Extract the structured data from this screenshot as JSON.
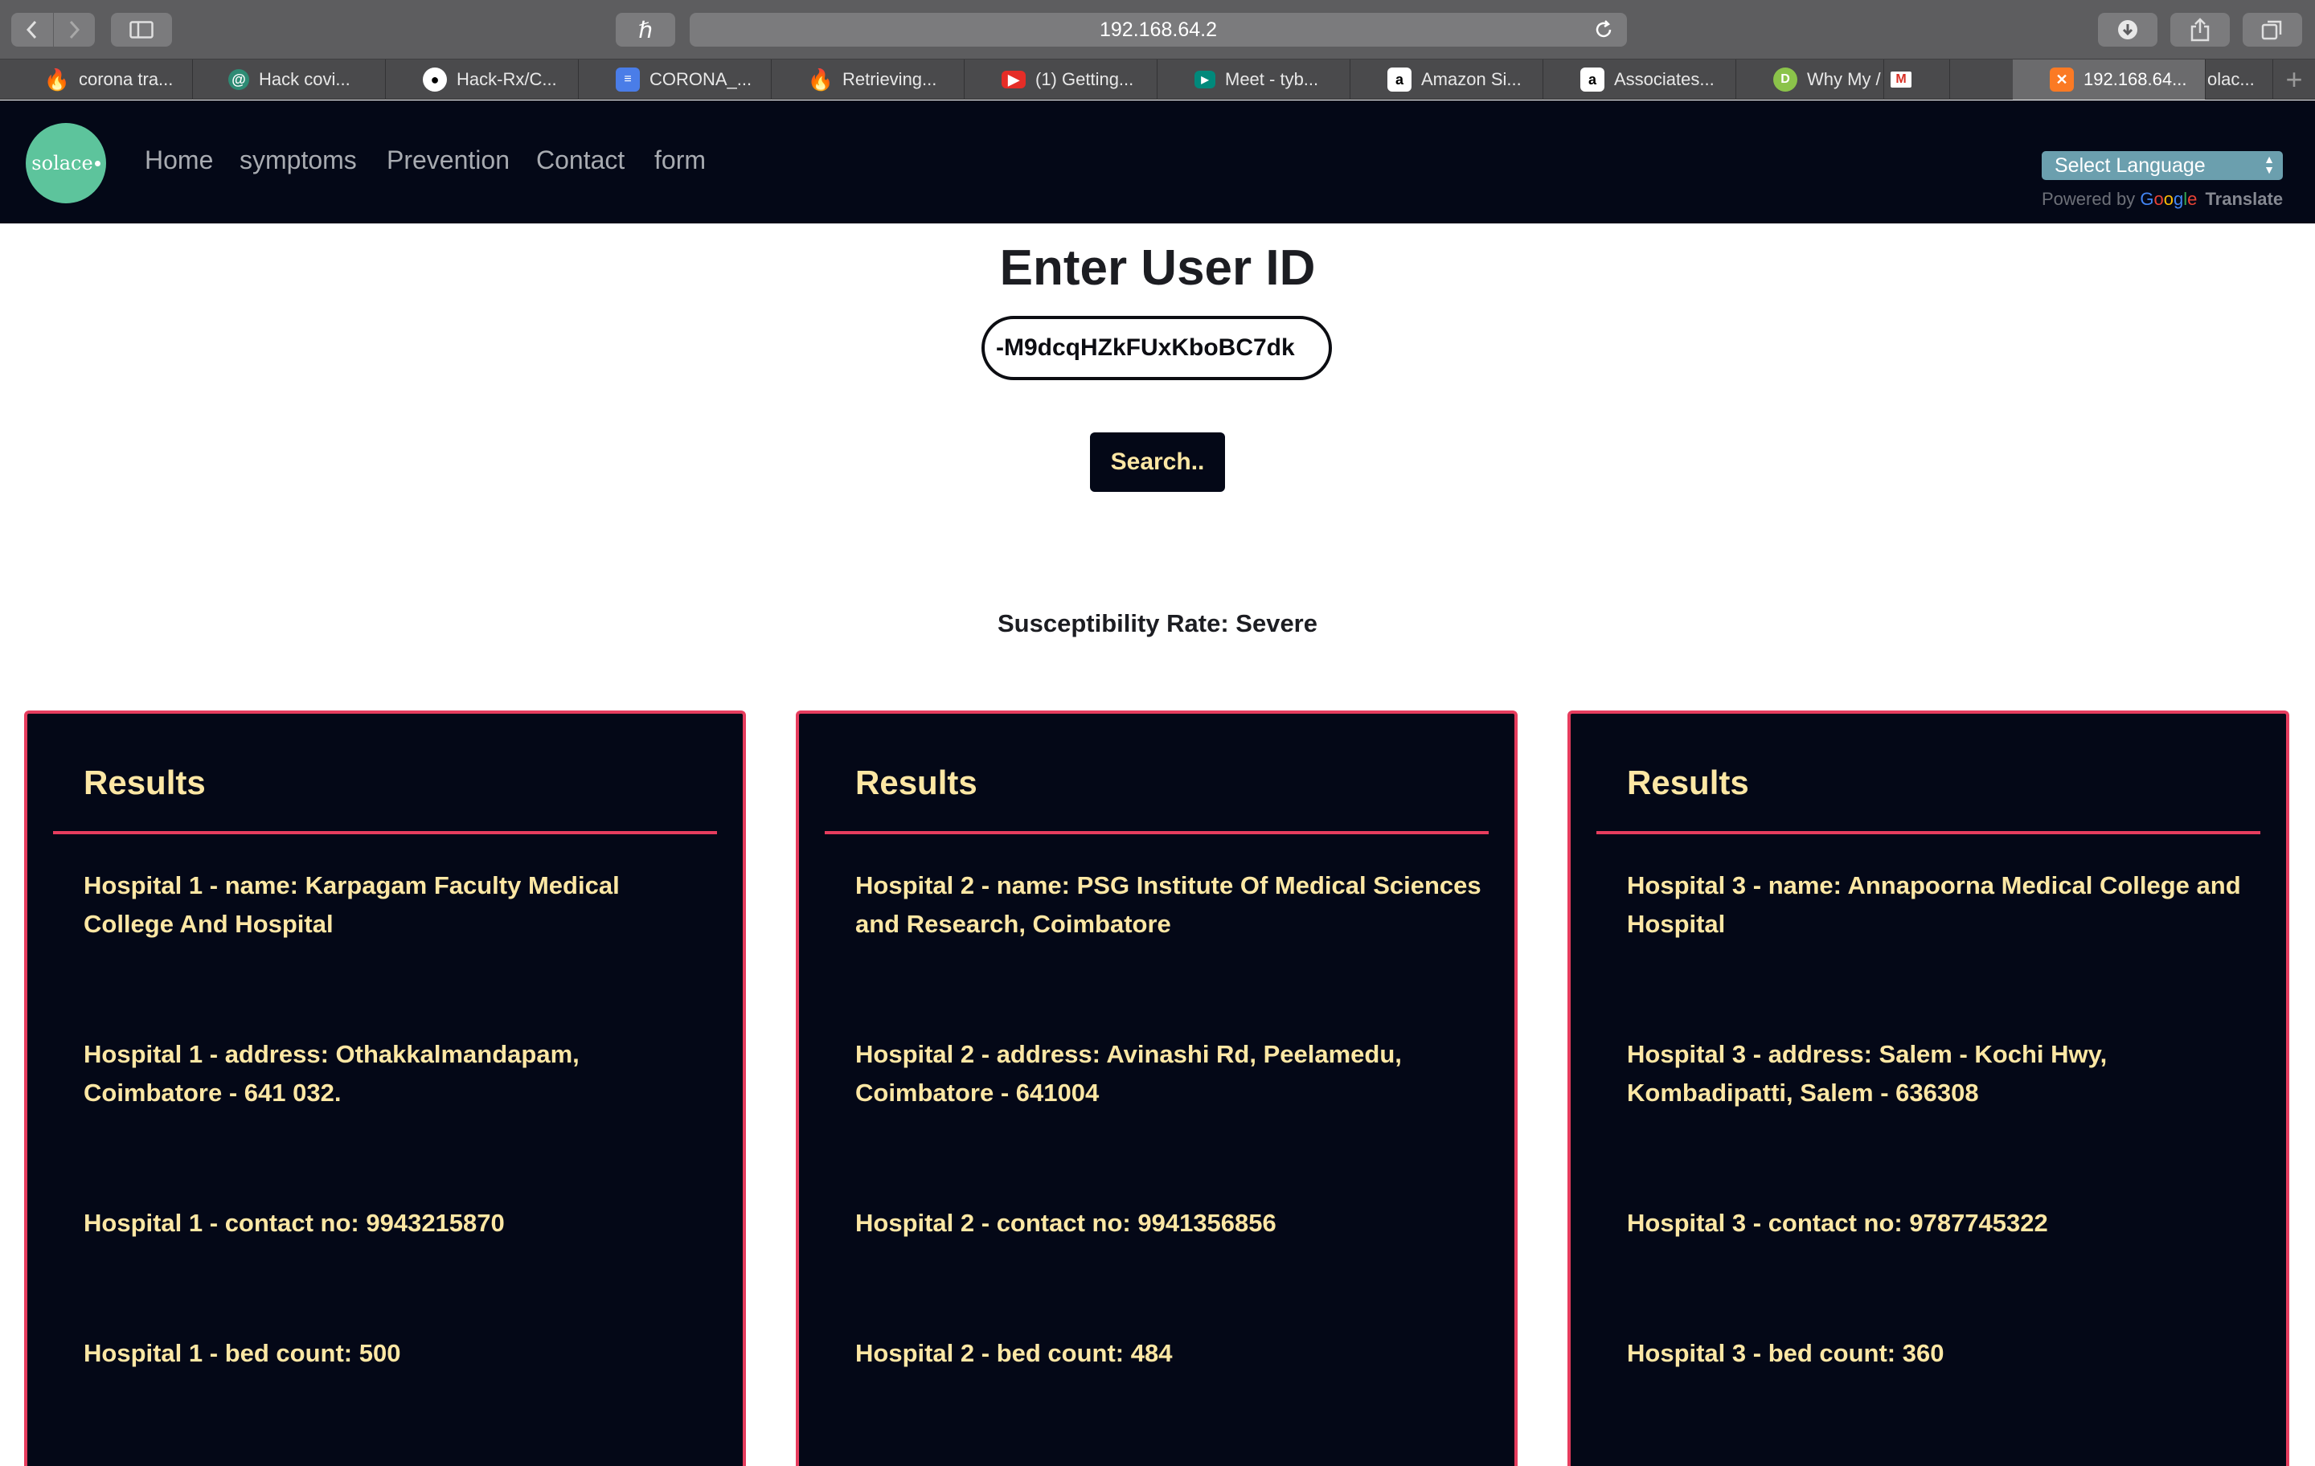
{
  "browser": {
    "address": "192.168.64.2",
    "tabs": [
      {
        "label": "corona tra...",
        "icon": "firebase-icon"
      },
      {
        "label": "Hack covi...",
        "icon": "devpost-icon"
      },
      {
        "label": "Hack-Rx/C...",
        "icon": "github-icon"
      },
      {
        "label": "CORONA_...",
        "icon": "google-docs-icon"
      },
      {
        "label": "Retrieving...",
        "icon": "firebase-icon"
      },
      {
        "label": "(1) Getting...",
        "icon": "youtube-icon"
      },
      {
        "label": "Meet - tyb...",
        "icon": "google-meet-icon"
      },
      {
        "label": "Amazon Si...",
        "icon": "amazon-icon"
      },
      {
        "label": "Associates...",
        "icon": "amazon-icon"
      },
      {
        "label": "Why My /",
        "icon": "d-icon"
      },
      {
        "label": "",
        "icon": "gmail-icon"
      },
      {
        "label": "192.168.64...",
        "icon": "xampp-icon"
      },
      {
        "label": "olac...",
        "icon": ""
      }
    ]
  },
  "site": {
    "logo_text": "solace",
    "nav": [
      "Home",
      "symptoms",
      "Prevention",
      "Contact",
      "form"
    ],
    "language_select": "Select Language",
    "powered_by": "Powered by",
    "translate": "Translate"
  },
  "main": {
    "title": "Enter User ID",
    "user_id_value": "-M9dcqHZkFUxKboBC7dk",
    "search_label": "Search..",
    "susceptibility": "Susceptibility Rate: Severe"
  },
  "results": [
    {
      "title": "Results",
      "name": "Hospital 1 - name: Karpagam Faculty Medical College And Hospital",
      "address": "Hospital 1 - address: Othakkalmandapam, Coimbatore - 641 032.",
      "contact": "Hospital 1 - contact no: 9943215870",
      "beds": "Hospital 1 - bed count: 500"
    },
    {
      "title": "Results",
      "name": "Hospital 2 - name: PSG Institute Of Medical Sciences and Research, Coimbatore",
      "address": "Hospital 2 - address: Avinashi Rd, Peelamedu, Coimbatore - 641004",
      "contact": "Hospital 2 - contact no: 9941356856",
      "beds": "Hospital 2 - bed count: 484"
    },
    {
      "title": "Results",
      "name": "Hospital 3 - name: Annapoorna Medical College and Hospital",
      "address": "Hospital 3 - address: Salem - Kochi Hwy, Kombadipatti, Salem - 636308",
      "contact": "Hospital 3 - contact no: 9787745322",
      "beds": "Hospital 3 - bed count: 360"
    }
  ],
  "colors": {
    "navbar_bg": "#040817",
    "accent_text": "#fde7a4",
    "card_border": "#e63d5e",
    "logo_bg": "#5dc49c"
  }
}
